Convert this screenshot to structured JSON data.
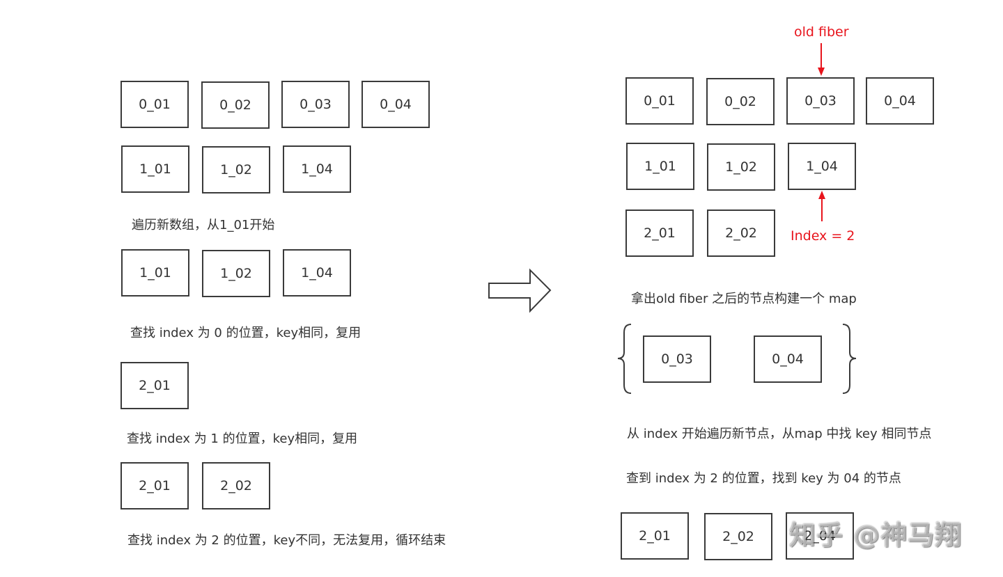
{
  "left": {
    "old_row": [
      "0_01",
      "0_02",
      "0_03",
      "0_04"
    ],
    "new_row_1": [
      "1_01",
      "1_02",
      "1_04"
    ],
    "note_1": "遍历新数组，从1_01开始",
    "new_row_2": [
      "1_01",
      "1_02",
      "1_04"
    ],
    "note_2": "查找 index 为 0 的位置，key相同，复用",
    "result_row_1": [
      "2_01"
    ],
    "note_3": "查找 index 为 1 的位置，key相同，复用",
    "result_row_2": [
      "2_01",
      "2_02"
    ],
    "note_4": "查找 index 为 2 的位置，key不同，无法复用，循环结束"
  },
  "right": {
    "old_fiber_label": "old fiber",
    "old_row": [
      "0_01",
      "0_02",
      "0_03",
      "0_04"
    ],
    "new_row": [
      "1_01",
      "1_02",
      "1_04"
    ],
    "result_row": [
      "2_01",
      "2_02"
    ],
    "index_label": "Index = 2",
    "note_map": "拿出old fiber 之后的节点构建一个 map",
    "map_items": [
      "0_03",
      "0_04"
    ],
    "note_traverse": "从 index 开始遍历新节点，从map 中找 key 相同节点",
    "note_found": "查到 index 为 2 的位置，找到 key 为 04 的节点",
    "final_row": [
      "2_01",
      "2_02",
      "2_04"
    ]
  },
  "watermark": "知乎 @神马翔",
  "colors": {
    "annotation": "#e8141c",
    "border": "#3a3a3a",
    "text": "#333333"
  }
}
